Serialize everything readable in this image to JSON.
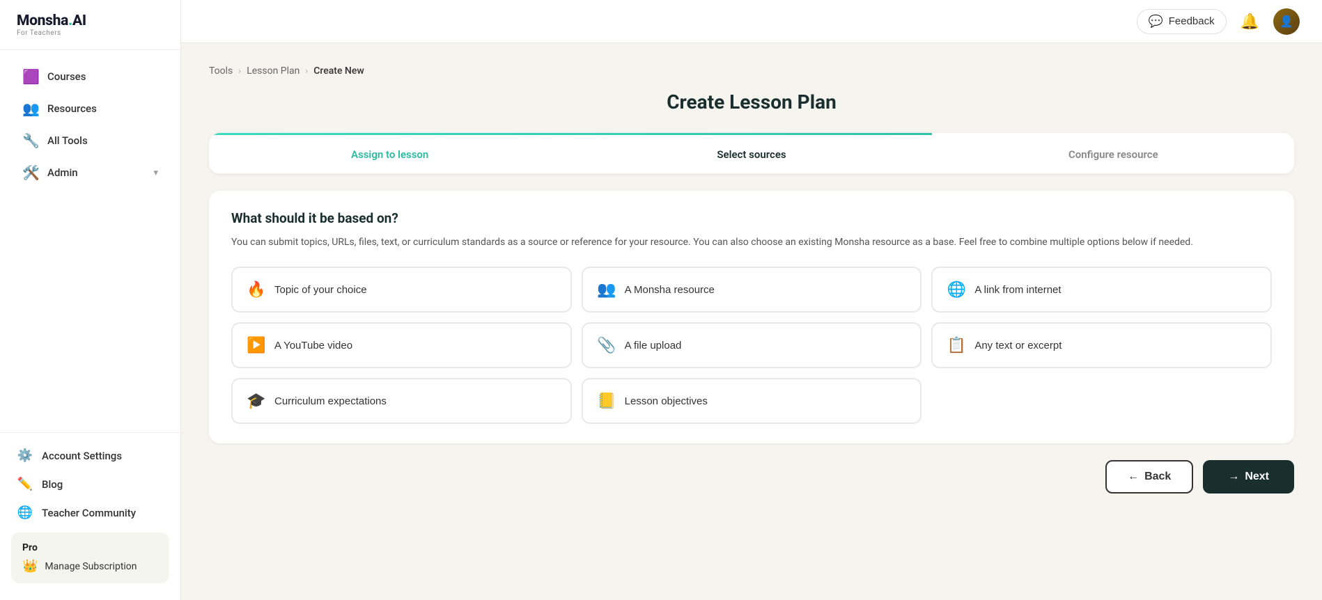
{
  "app": {
    "name": "Monsha.AI",
    "tagline": "For Teachers"
  },
  "header": {
    "feedback_label": "Feedback",
    "notification_icon": "🔔",
    "avatar_initials": "👤"
  },
  "sidebar": {
    "nav_items": [
      {
        "id": "courses",
        "label": "Courses",
        "icon": "🟪"
      },
      {
        "id": "resources",
        "label": "Resources",
        "icon": "👥"
      },
      {
        "id": "all-tools",
        "label": "All Tools",
        "icon": "🔧"
      },
      {
        "id": "admin",
        "label": "Admin",
        "icon": "🛠️",
        "has_chevron": true
      }
    ],
    "bottom_items": [
      {
        "id": "account-settings",
        "label": "Account Settings",
        "icon": "⚙️",
        "icon_color": "#4CAF50"
      },
      {
        "id": "blog",
        "label": "Blog",
        "icon": "✏️",
        "icon_color": "#2196F3"
      },
      {
        "id": "teacher-community",
        "label": "Teacher Community",
        "icon": "🌐",
        "icon_color": "#FF5722"
      }
    ],
    "pro": {
      "label": "Pro",
      "manage_label": "Manage Subscription",
      "manage_icon": "👑"
    }
  },
  "breadcrumb": {
    "items": [
      "Tools",
      "Lesson Plan",
      "Create New"
    ]
  },
  "page": {
    "title": "Create Lesson Plan"
  },
  "steps": {
    "tabs": [
      {
        "id": "assign",
        "label": "Assign to lesson",
        "state": "active"
      },
      {
        "id": "sources",
        "label": "Select sources",
        "state": "done"
      },
      {
        "id": "configure",
        "label": "Configure resource",
        "state": "inactive"
      }
    ],
    "progress_pct": "66.6%"
  },
  "sources_section": {
    "title": "What should it be based on?",
    "description": "You can submit topics, URLs, files, text, or curriculum standards as a source or reference for your resource. You can also choose an existing Monsha resource as a base. Feel free to combine multiple options below if needed.",
    "options": [
      {
        "id": "topic",
        "label": "Topic of your choice",
        "icon": "🔥",
        "icon_type": "emoji"
      },
      {
        "id": "monsha",
        "label": "A Monsha resource",
        "icon": "👥",
        "icon_type": "emoji"
      },
      {
        "id": "link",
        "label": "A link from internet",
        "icon": "🌐",
        "icon_type": "emoji"
      },
      {
        "id": "youtube",
        "label": "A YouTube video",
        "icon": "▶️",
        "icon_type": "emoji"
      },
      {
        "id": "file",
        "label": "A file upload",
        "icon": "📎",
        "icon_type": "emoji"
      },
      {
        "id": "text",
        "label": "Any text or excerpt",
        "icon": "📋",
        "icon_type": "emoji"
      },
      {
        "id": "curriculum",
        "label": "Curriculum expectations",
        "icon": "🎓",
        "icon_type": "emoji"
      },
      {
        "id": "objectives",
        "label": "Lesson objectives",
        "icon": "📒",
        "icon_type": "emoji"
      }
    ]
  },
  "buttons": {
    "back_label": "Back",
    "next_label": "Next",
    "back_arrow": "←",
    "next_arrow": "→"
  }
}
